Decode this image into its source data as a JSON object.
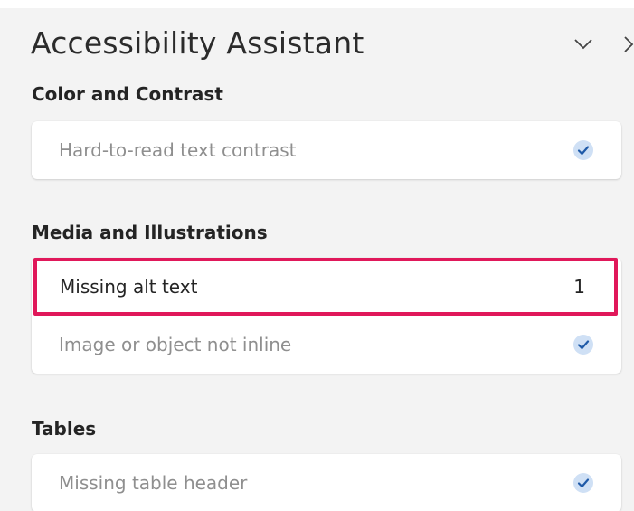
{
  "panel": {
    "title": "Accessibility Assistant"
  },
  "sections": [
    {
      "heading": "Color and Contrast",
      "items": [
        {
          "label": "Hard-to-read text contrast",
          "status": "passed"
        }
      ]
    },
    {
      "heading": "Media and Illustrations",
      "items": [
        {
          "label": "Missing alt text",
          "status": "issue",
          "count": "1"
        },
        {
          "label": "Image or object not inline",
          "status": "passed"
        }
      ]
    },
    {
      "heading": "Tables",
      "items": [
        {
          "label": "Missing table header",
          "status": "passed"
        }
      ]
    }
  ],
  "icons": {
    "collapse": "chevron-down-icon",
    "close": "close-icon",
    "passed": "checkmark-circle-icon"
  },
  "colors": {
    "highlight_border": "#e0185a",
    "check_fill": "#cfe0f5",
    "check_mark": "#1f5aa8"
  }
}
